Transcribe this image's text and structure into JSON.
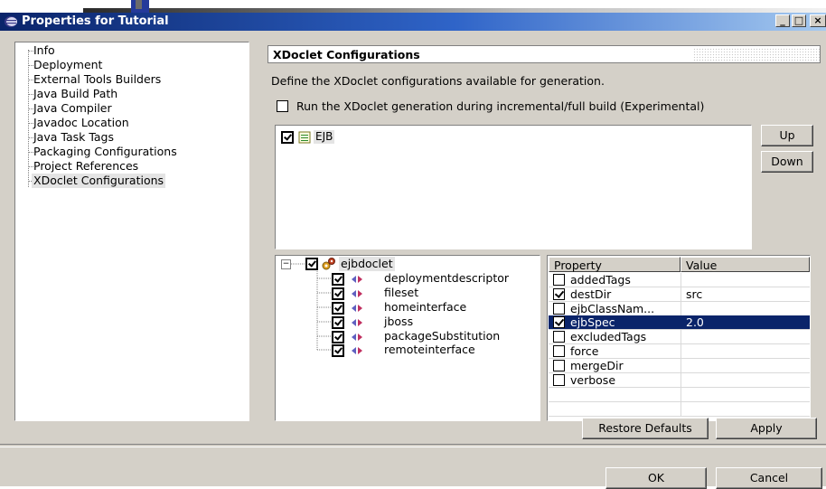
{
  "window": {
    "title": "Properties for Tutorial",
    "controls": [
      "_",
      "□",
      "×"
    ]
  },
  "nav_tree": {
    "items": [
      {
        "label": "Info"
      },
      {
        "label": "Deployment"
      },
      {
        "label": "External Tools Builders"
      },
      {
        "label": "Java Build Path"
      },
      {
        "label": "Java Compiler"
      },
      {
        "label": "Javadoc Location"
      },
      {
        "label": "Java Task Tags"
      },
      {
        "label": "Packaging Configurations"
      },
      {
        "label": "Project References"
      },
      {
        "label": "XDoclet Configurations",
        "selected": true
      }
    ]
  },
  "page": {
    "title": "XDoclet Configurations",
    "description": "Define the XDoclet configurations available for generation.",
    "run_option": {
      "label": "Run the XDoclet generation during incremental/full build (Experimental)",
      "checked": false
    }
  },
  "configurations": [
    {
      "label": "EJB",
      "checked": true,
      "selected": true
    }
  ],
  "config_buttons": {
    "up": "Up",
    "down": "Down"
  },
  "doclet_tree": {
    "root": {
      "label": "ejbdoclet",
      "checked": true,
      "expanded": true,
      "expander": "−"
    },
    "children": [
      {
        "label": "deploymentdescriptor",
        "checked": true
      },
      {
        "label": "fileset",
        "checked": true
      },
      {
        "label": "homeinterface",
        "checked": true
      },
      {
        "label": "jboss",
        "checked": true
      },
      {
        "label": "packageSubstitution",
        "checked": true
      },
      {
        "label": "remoteinterface",
        "checked": true
      }
    ]
  },
  "property_table": {
    "columns": [
      "Property",
      "Value"
    ],
    "rows": [
      {
        "property": "addedTags",
        "value": "",
        "checked": false
      },
      {
        "property": "destDir",
        "value": "src",
        "checked": true
      },
      {
        "property": "ejbClassNam...",
        "value": "",
        "checked": false
      },
      {
        "property": "ejbSpec",
        "value": "2.0",
        "checked": true,
        "selected": true
      },
      {
        "property": "excludedTags",
        "value": "",
        "checked": false
      },
      {
        "property": "force",
        "value": "",
        "checked": false
      },
      {
        "property": "mergeDir",
        "value": "",
        "checked": false
      },
      {
        "property": "verbose",
        "value": "",
        "checked": false
      }
    ]
  },
  "page_buttons": {
    "restore_defaults": "Restore Defaults",
    "apply": "Apply"
  },
  "dialog_buttons": {
    "ok": "OK",
    "cancel": "Cancel"
  },
  "colors": {
    "titlebar_start": "#0a246a",
    "titlebar_end": "#a6caf0",
    "dialog_bg": "#d4d0c8",
    "selection": "#0a246a"
  }
}
